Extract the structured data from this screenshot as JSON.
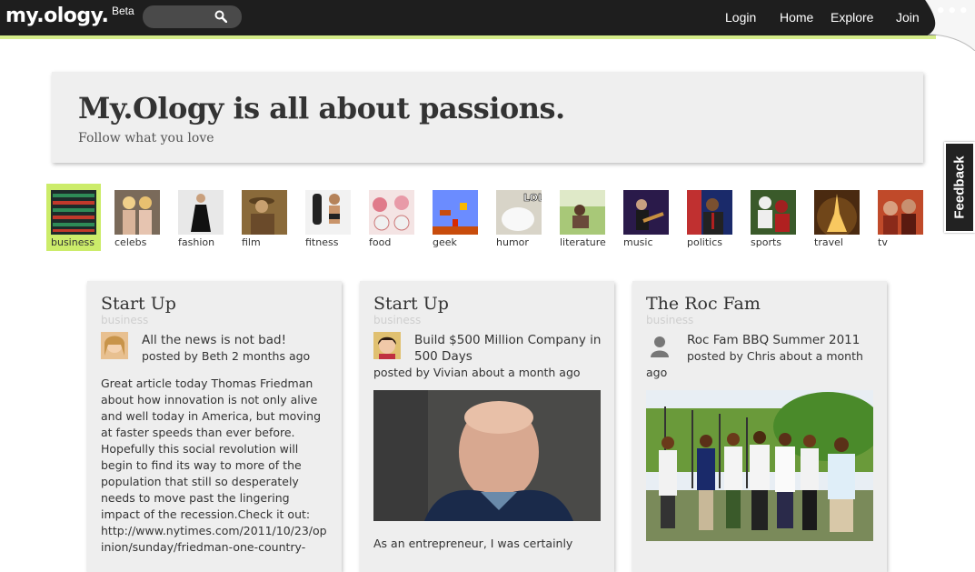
{
  "app": {
    "logo": "my.ology.",
    "beta": "Beta"
  },
  "nav": {
    "login": "Login",
    "home": "Home",
    "explore": "Explore",
    "join": "Join"
  },
  "hero": {
    "title": "My.Ology is all about passions.",
    "subtitle": "Follow what you love"
  },
  "feedback": "Feedback",
  "categories": [
    {
      "label": "business",
      "selected": true
    },
    {
      "label": "celebs"
    },
    {
      "label": "fashion"
    },
    {
      "label": "film"
    },
    {
      "label": "fitness"
    },
    {
      "label": "food"
    },
    {
      "label": "geek"
    },
    {
      "label": "humor"
    },
    {
      "label": "literature"
    },
    {
      "label": "music"
    },
    {
      "label": "politics"
    },
    {
      "label": "sports"
    },
    {
      "label": "travel"
    },
    {
      "label": "tv"
    }
  ],
  "cards": [
    {
      "title": "Start Up",
      "category": "business",
      "post_title": "All the news is not bad!",
      "meta": "posted by Beth 2 months ago",
      "body": "Great article today Thomas Friedman about how innovation is not only alive and well today in America, but moving at faster speeds than ever before. Hopefully this social revolution will begin to find its way to more of the population that still so desperately needs to move past the lingering impact of the recession.Check it out: http://www.nytimes.com/2011/10/23/opinion/sunday/friedman-one-country-"
    },
    {
      "title": "Start Up",
      "category": "business",
      "post_title": "Build $500 Million Company in 500 Days",
      "meta": "posted by Vivian about a month ago",
      "body": "As an entrepreneur, I was certainly"
    },
    {
      "title": "The Roc Fam",
      "category": "business",
      "post_title": "Roc Fam BBQ Summer 2011",
      "meta": "posted by Chris about a month ago"
    }
  ],
  "colors": {
    "topbar": "#1e1e1e",
    "accent": "#d5ec8a",
    "selected_category": "#ccec6a",
    "card_bg": "#eeeeee"
  }
}
